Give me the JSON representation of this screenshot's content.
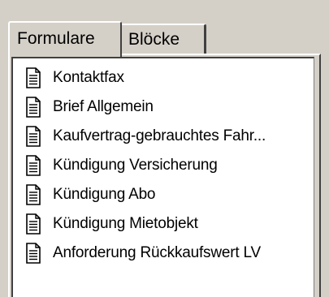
{
  "tabs": [
    {
      "label": "Formulare",
      "active": true
    },
    {
      "label": "Blöcke",
      "active": false
    }
  ],
  "items": [
    {
      "label": "Kontaktfax",
      "icon": "document-icon"
    },
    {
      "label": "Brief Allgemein",
      "icon": "document-icon"
    },
    {
      "label": "Kaufvertrag-gebrauchtes Fahr...",
      "icon": "document-icon"
    },
    {
      "label": "Kündigung Versicherung",
      "icon": "document-icon"
    },
    {
      "label": "Kündigung Abo",
      "icon": "document-icon"
    },
    {
      "label": "Kündigung Mietobjekt",
      "icon": "document-icon"
    },
    {
      "label": "Anforderung Rückkaufswert LV",
      "icon": "document-icon"
    }
  ],
  "colors": {
    "panel_bg": "#d4d0c8",
    "list_bg": "#ffffff",
    "text": "#000000"
  }
}
